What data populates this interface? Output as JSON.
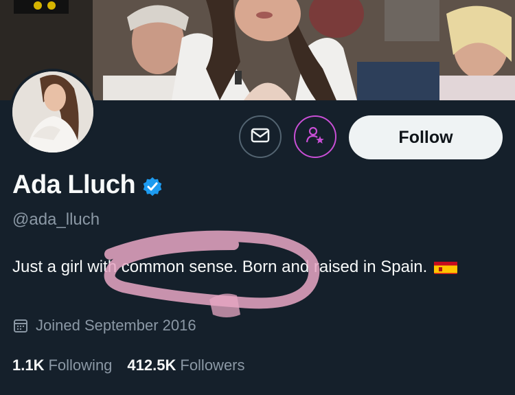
{
  "profile": {
    "name": "Ada Lluch",
    "handle": "@ada_lluch",
    "bio_text": "Just a girl with common sense. Born and raised in Spain.",
    "bio_flag": "spain-flag-emoji",
    "joined": "Joined September 2016",
    "verified": true
  },
  "actions": {
    "follow_label": "Follow",
    "message_icon": "envelope-icon",
    "subscribe_icon": "person-star-icon"
  },
  "stats": {
    "following_count": "1.1K",
    "following_label": "Following",
    "followers_count": "412.5K",
    "followers_label": "Followers"
  },
  "colors": {
    "background": "#15202b",
    "verified_badge": "#1d9bf0",
    "subscribe_accent": "#c94fd6",
    "scribble": "#e8a7c4"
  }
}
